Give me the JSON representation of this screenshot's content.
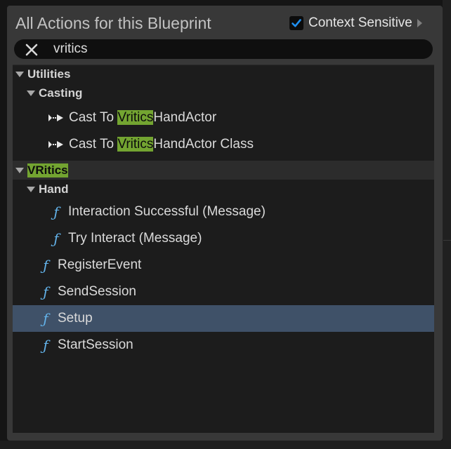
{
  "header": {
    "title": "All Actions for this Blueprint",
    "context_sensitive": {
      "label": "Context Sensitive",
      "checked": true,
      "expand_icon": "triangle-right-icon"
    }
  },
  "search": {
    "value": "vritics",
    "clear_icon": "close-icon"
  },
  "tree": {
    "utilities": {
      "label": "Utilities",
      "casting": {
        "label": "Casting",
        "items": [
          {
            "prefix": "Cast To ",
            "match": "Vritics",
            "suffix": "HandActor",
            "icon": "cast-node-icon"
          },
          {
            "prefix": "Cast To ",
            "match": "Vritics",
            "suffix": "HandActor Class",
            "icon": "cast-node-icon"
          }
        ]
      }
    },
    "vritics": {
      "label": "VRitics",
      "hand": {
        "label": "Hand",
        "items": [
          {
            "label": "Interaction Successful (Message)",
            "icon": "function-icon"
          },
          {
            "label": "Try Interact (Message)",
            "icon": "function-icon"
          }
        ]
      },
      "items": [
        {
          "label": "RegisterEvent",
          "icon": "function-icon"
        },
        {
          "label": "SendSession",
          "icon": "function-icon"
        },
        {
          "label": "Setup",
          "icon": "function-icon",
          "selected": true
        },
        {
          "label": "StartSession",
          "icon": "function-icon"
        }
      ]
    },
    "function_glyph": "ƒ"
  },
  "colors": {
    "highlight": "#73a431",
    "selection": "#3f5168",
    "function_icon": "#63b3ea",
    "checkbox_check": "#1f8ff0"
  }
}
